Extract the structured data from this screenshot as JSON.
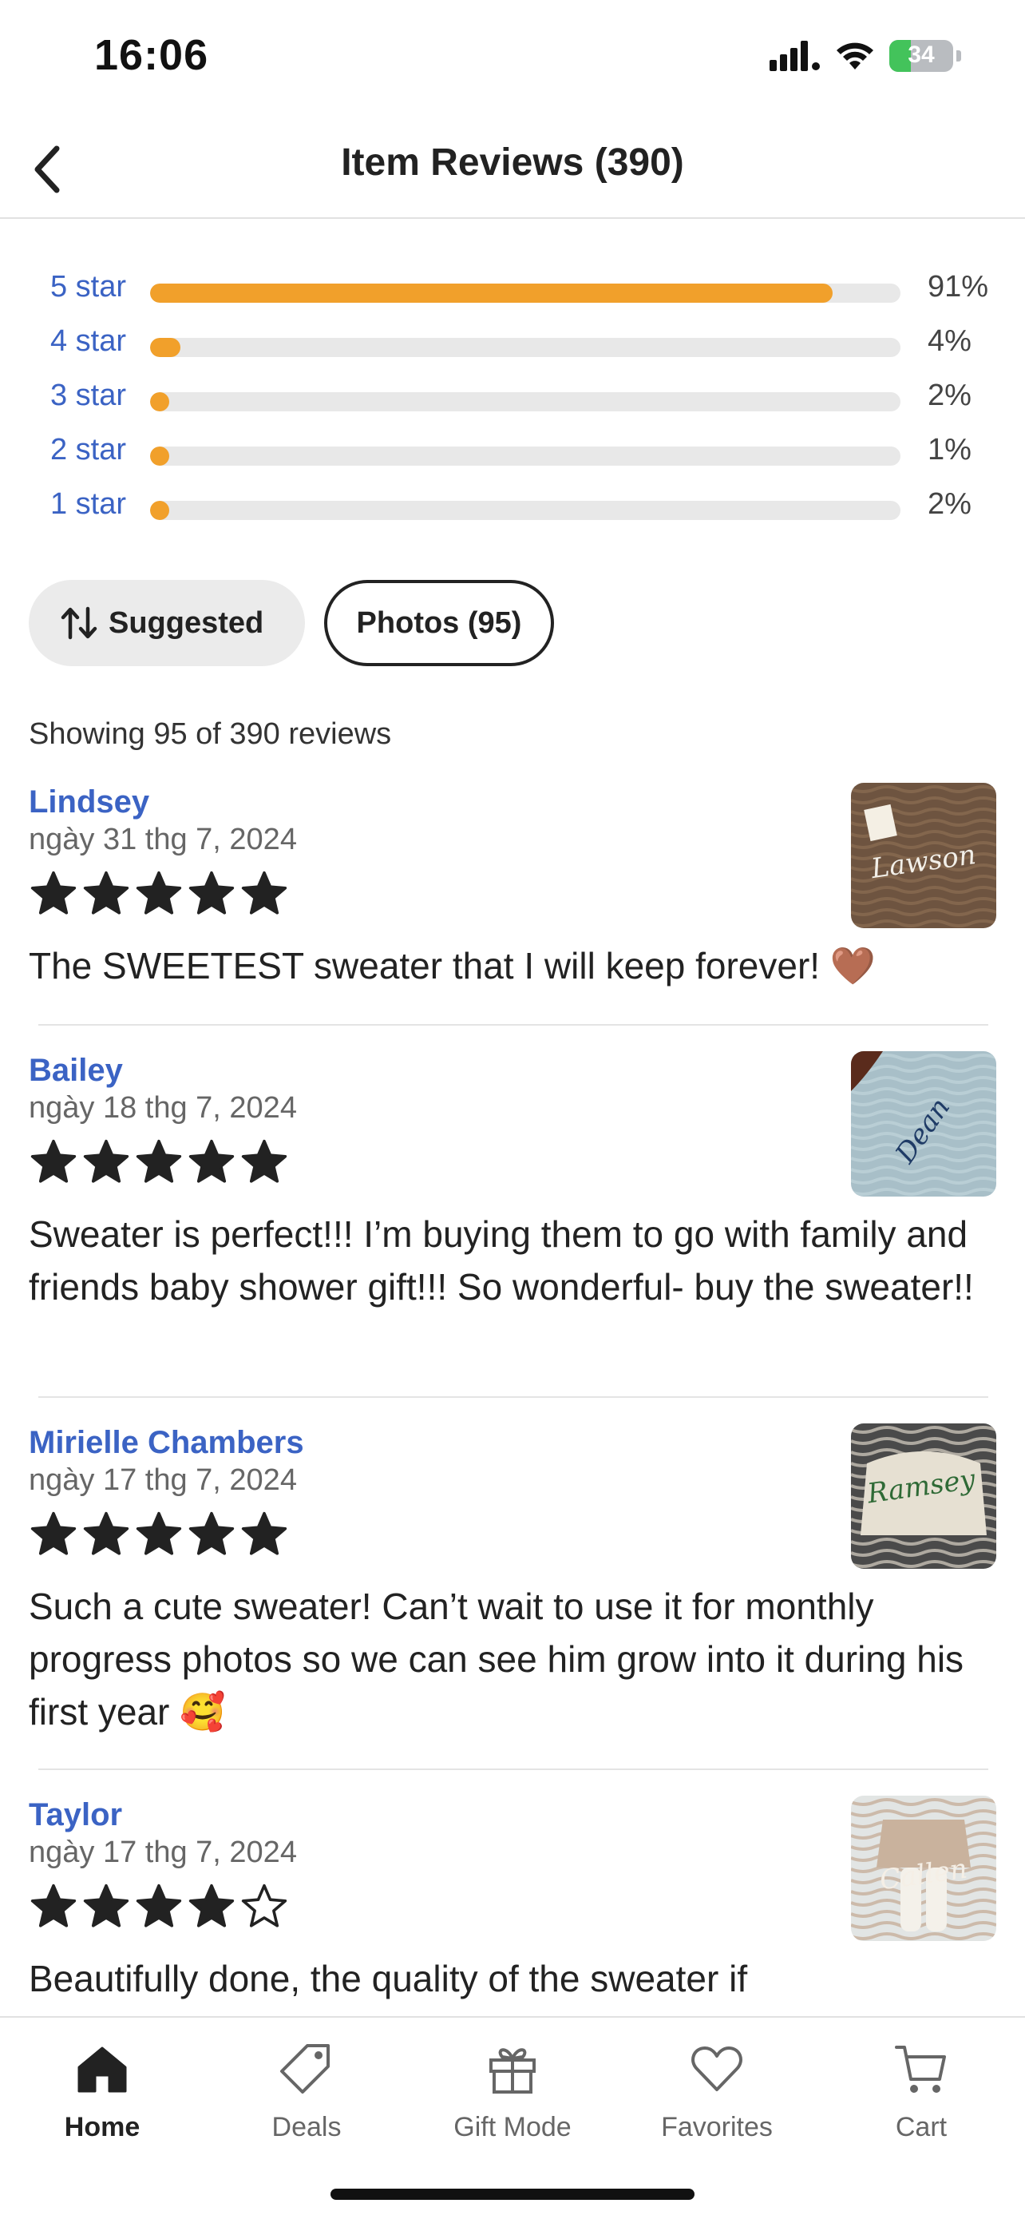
{
  "status_bar": {
    "time": "16:06",
    "battery": "34",
    "battery_level": 0.34
  },
  "header": {
    "title": "Item Reviews (390)",
    "back_icon": "chevron-left-icon"
  },
  "ratings": [
    {
      "label": "5 star",
      "percent": 91,
      "display": "91%"
    },
    {
      "label": "4 star",
      "percent": 4,
      "display": "4%"
    },
    {
      "label": "3 star",
      "percent": 2,
      "display": "2%"
    },
    {
      "label": "2 star",
      "percent": 1,
      "display": "1%"
    },
    {
      "label": "1 star",
      "percent": 2,
      "display": "2%"
    }
  ],
  "filters": {
    "sort_label": "Suggested",
    "photos_label": "Photos (95)"
  },
  "showing_text": "Showing 95 of 390 reviews",
  "reviews": [
    {
      "name": "Lindsey",
      "date": "ngày 31 thg 7, 2024",
      "rating": 5,
      "text": "The SWEETEST sweater that I will keep forever! 🤎",
      "photo_text": "Lawson"
    },
    {
      "name": "Bailey",
      "date": "ngày 18 thg 7, 2024",
      "rating": 5,
      "text": "Sweater is perfect!!! I’m buying them to go with family and friends baby shower gift!!! So wonderful- buy the sweater!!",
      "photo_text": "Dean"
    },
    {
      "name": "Mirielle Chambers",
      "date": "ngày 17 thg 7, 2024",
      "rating": 5,
      "text": "Such a cute sweater! Can’t wait to use it for monthly progress photos so we can see him grow into it during his first year 🥰",
      "photo_text": "Ramsey"
    },
    {
      "name": "Taylor",
      "date": "ngày 17 thg 7, 2024",
      "rating": 4,
      "text": "Beautifully done, the quality of the sweater if",
      "photo_text": "Callen"
    }
  ],
  "nav": [
    {
      "label": "Home",
      "icon": "home-icon",
      "active": true
    },
    {
      "label": "Deals",
      "icon": "tag-icon",
      "active": false
    },
    {
      "label": "Gift Mode",
      "icon": "gift-icon",
      "active": false
    },
    {
      "label": "Favorites",
      "icon": "heart-icon",
      "active": false
    },
    {
      "label": "Cart",
      "icon": "cart-icon",
      "active": false
    }
  ],
  "colors": {
    "accent_blue": "#3b63c4",
    "bar_orange": "#f1a02b"
  }
}
